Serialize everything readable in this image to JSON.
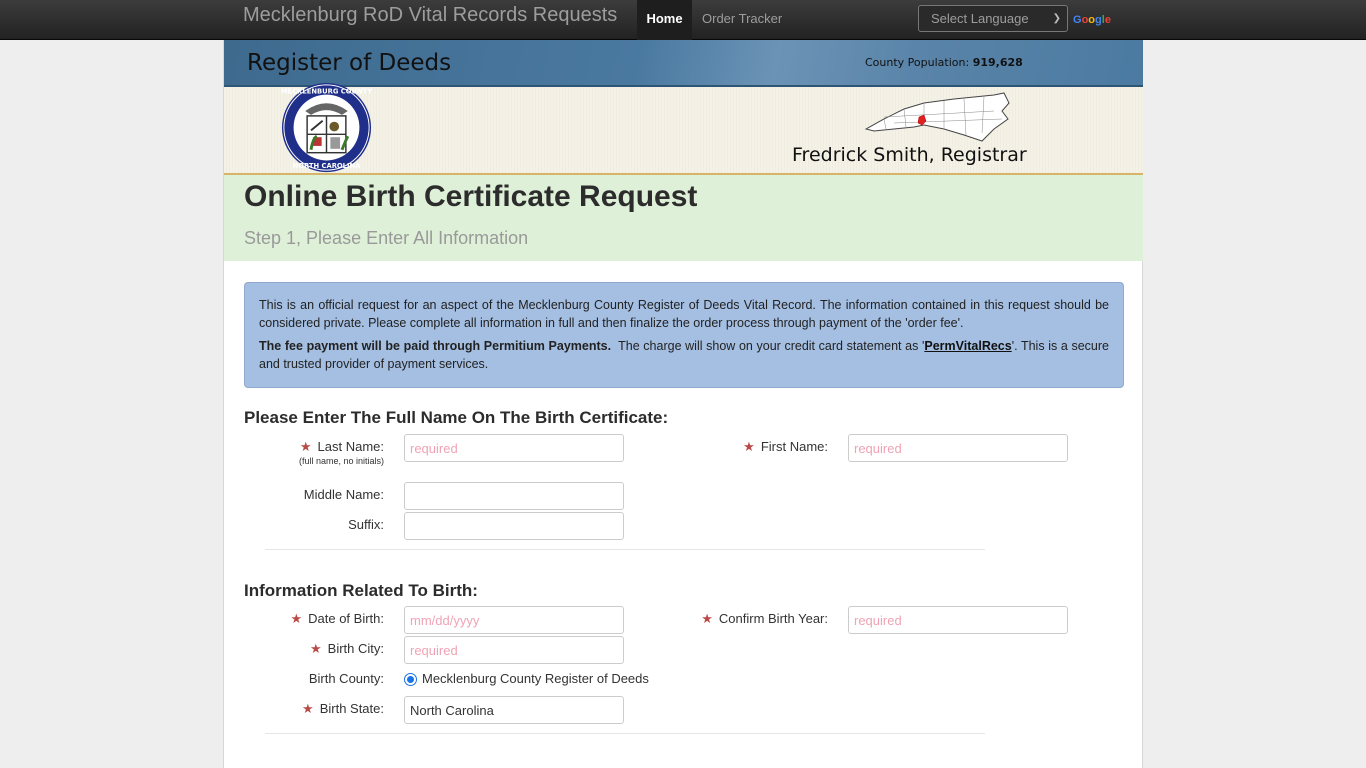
{
  "navbar": {
    "brand": "Mecklenburg RoD Vital Records Requests",
    "items": [
      {
        "label": "Home",
        "active": true
      },
      {
        "label": "Order Tracker",
        "active": false
      }
    ],
    "language_select": {
      "selected": "Select Language"
    },
    "google_label": [
      "G",
      "o",
      "o",
      "g",
      "l",
      "e"
    ]
  },
  "banner": {
    "title": "Register of Deeds",
    "population_label": "County Population:",
    "population_value": "919,628",
    "registrar": "Fredrick Smith, Registrar",
    "seal_icon": "mecklenburg-county-seal",
    "map_icon": "north-carolina-map",
    "map_highlight_color": "#e02020"
  },
  "header": {
    "title": "Online Birth Certificate Request",
    "subtitle": "Step 1, Please Enter All Information"
  },
  "notice": {
    "paragraph1": "This is an official request for an aspect of the Mecklenburg County Register of Deeds Vital Record. The information contained in this request should be considered private. Please complete all information in full and then finalize the order process through payment of the 'order fee'.",
    "paragraph2_bold": "The fee payment will be paid through Permitium Payments.",
    "paragraph2_pre": "  The charge will show on your credit card statement as '",
    "paragraph2_link": "PermVitalRecs",
    "paragraph2_post": "'. This is a secure and trusted provider of payment services."
  },
  "name_section": {
    "heading": "Please Enter The Full Name On The Birth Certificate:",
    "last_name": {
      "label": "Last Name:",
      "hint": "(full name, no initials)",
      "placeholder": "required",
      "value": "",
      "required": true
    },
    "first_name": {
      "label": "First Name:",
      "placeholder": "required",
      "value": "",
      "required": true
    },
    "middle_name": {
      "label": "Middle Name:",
      "placeholder": "",
      "value": "",
      "required": false
    },
    "suffix": {
      "label": "Suffix:",
      "placeholder": "",
      "value": "",
      "required": false
    }
  },
  "birth_section": {
    "heading": "Information Related To Birth:",
    "date_of_birth": {
      "label": "Date of Birth:",
      "placeholder": "mm/dd/yyyy",
      "value": "",
      "required": true
    },
    "confirm_birth_year": {
      "label": "Confirm Birth Year:",
      "placeholder": "required",
      "value": "",
      "required": true
    },
    "birth_city": {
      "label": "Birth City:",
      "placeholder": "required",
      "value": "",
      "required": true
    },
    "birth_county": {
      "label": "Birth County:",
      "option": "Mecklenburg County Register of Deeds",
      "selected": true
    },
    "birth_state": {
      "label": "Birth State:",
      "value": "North Carolina",
      "required": true
    }
  },
  "required_marker": "★",
  "colors": {
    "navbar_bg": "#222222",
    "banner_blue": "#4a79a0",
    "title_band": "#dff0d8",
    "notice_bg": "#a4bfe2",
    "required_star": "#b94a48",
    "placeholder": "#f0a3b5"
  }
}
